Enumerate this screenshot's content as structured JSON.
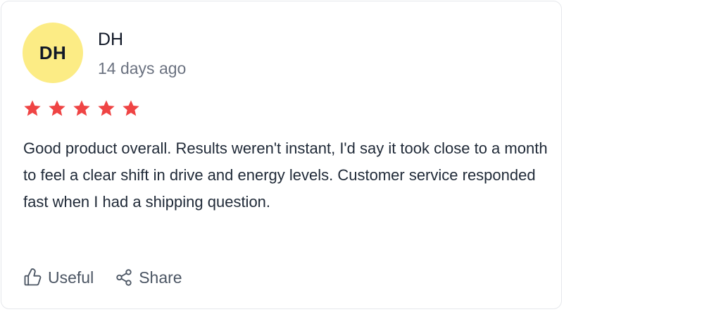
{
  "review": {
    "author_initials": "DH",
    "author_name": "DH",
    "posted": "14 days ago",
    "rating": 5,
    "rating_max": 5,
    "body": "Good product overall. Results weren't instant, I'd say it took close to a month to feel a clear shift in drive and energy levels. Customer service responded fast when I had a shipping question."
  },
  "actions": {
    "useful_label": "Useful",
    "share_label": "Share"
  },
  "colors": {
    "avatar_bg": "#fcec85",
    "star": "#ef4444",
    "muted_text": "#6b7280"
  },
  "icons": {
    "useful": "thumbs-up-icon",
    "share": "share-icon",
    "star": "star-icon"
  }
}
